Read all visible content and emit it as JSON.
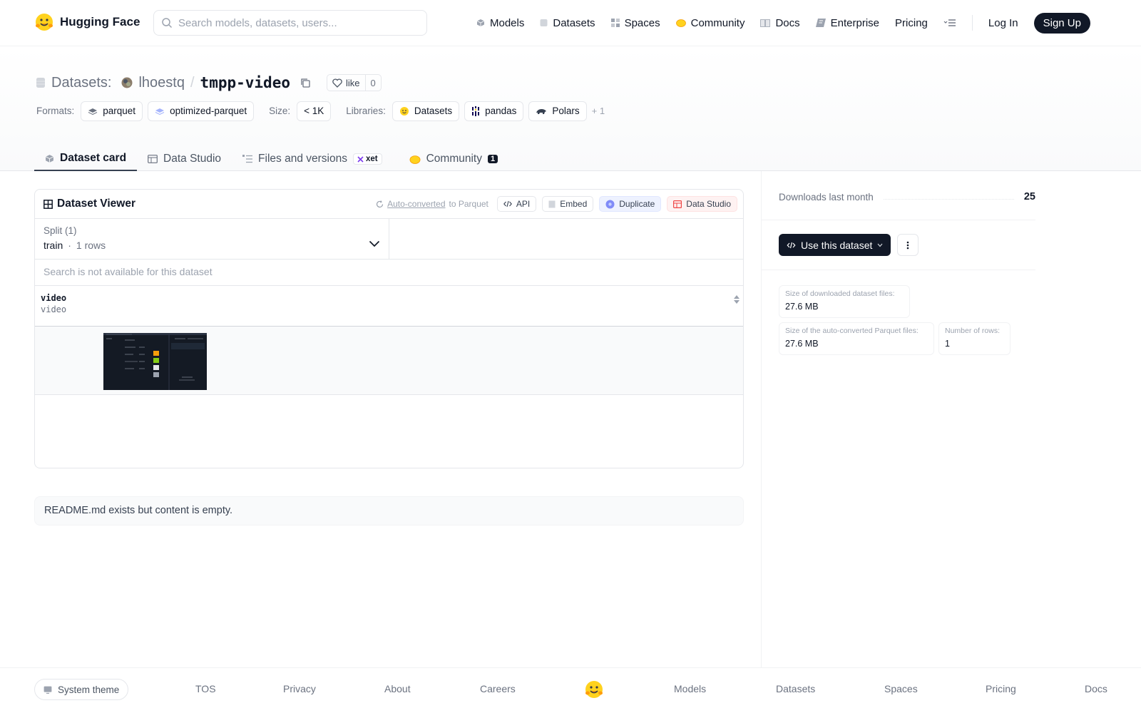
{
  "nav": {
    "brand": "Hugging Face",
    "search_placeholder": "Search models, datasets, users...",
    "links": [
      "Models",
      "Datasets",
      "Spaces",
      "Community",
      "Docs",
      "Enterprise",
      "Pricing"
    ],
    "login": "Log In",
    "signup": "Sign Up"
  },
  "header": {
    "section_label": "Datasets:",
    "owner": "lhoestq",
    "separator": "/",
    "repo": "tmpp-video",
    "like_label": "like",
    "like_count": "0",
    "formats_label": "Formats:",
    "formats": [
      "parquet",
      "optimized-parquet"
    ],
    "size_label": "Size:",
    "size_value": "< 1K",
    "libraries_label": "Libraries:",
    "libraries": [
      "Datasets",
      "pandas",
      "Polars"
    ],
    "libraries_more": "+ 1"
  },
  "tabs": {
    "dataset_card": "Dataset card",
    "data_studio": "Data Studio",
    "files": "Files and versions",
    "xet": "xet",
    "community": "Community",
    "community_count": "1"
  },
  "viewer": {
    "title": "Dataset Viewer",
    "auto_converted": "Auto-converted",
    "to_parquet": "to Parquet",
    "api": "API",
    "embed": "Embed",
    "duplicate": "Duplicate",
    "data_studio": "Data Studio",
    "split_label": "Split (1)",
    "split_name": "train",
    "split_dot": "·",
    "split_rows": "1 rows",
    "search_unavailable": "Search is not available for this dataset",
    "column_name": "video",
    "column_type": "video"
  },
  "readme": "README.md exists but content is empty.",
  "sidebar": {
    "downloads_label": "Downloads last month",
    "downloads_value": "25",
    "use_button": "Use this dataset",
    "stats": [
      {
        "label": "Size of downloaded dataset files:",
        "value": "27.6 MB"
      },
      {
        "label": "Size of the auto-converted Parquet files:",
        "value": "27.6 MB"
      },
      {
        "label": "Number of rows:",
        "value": "1"
      }
    ]
  },
  "footer": {
    "theme": "System theme",
    "links": [
      "TOS",
      "Privacy",
      "About",
      "Careers",
      "Models",
      "Datasets",
      "Spaces",
      "Pricing",
      "Docs"
    ]
  },
  "colors": {
    "primary_dark": "#111827",
    "border": "#e5e7eb",
    "muted": "#6b7280",
    "hf_yellow": "#FFD21E"
  }
}
